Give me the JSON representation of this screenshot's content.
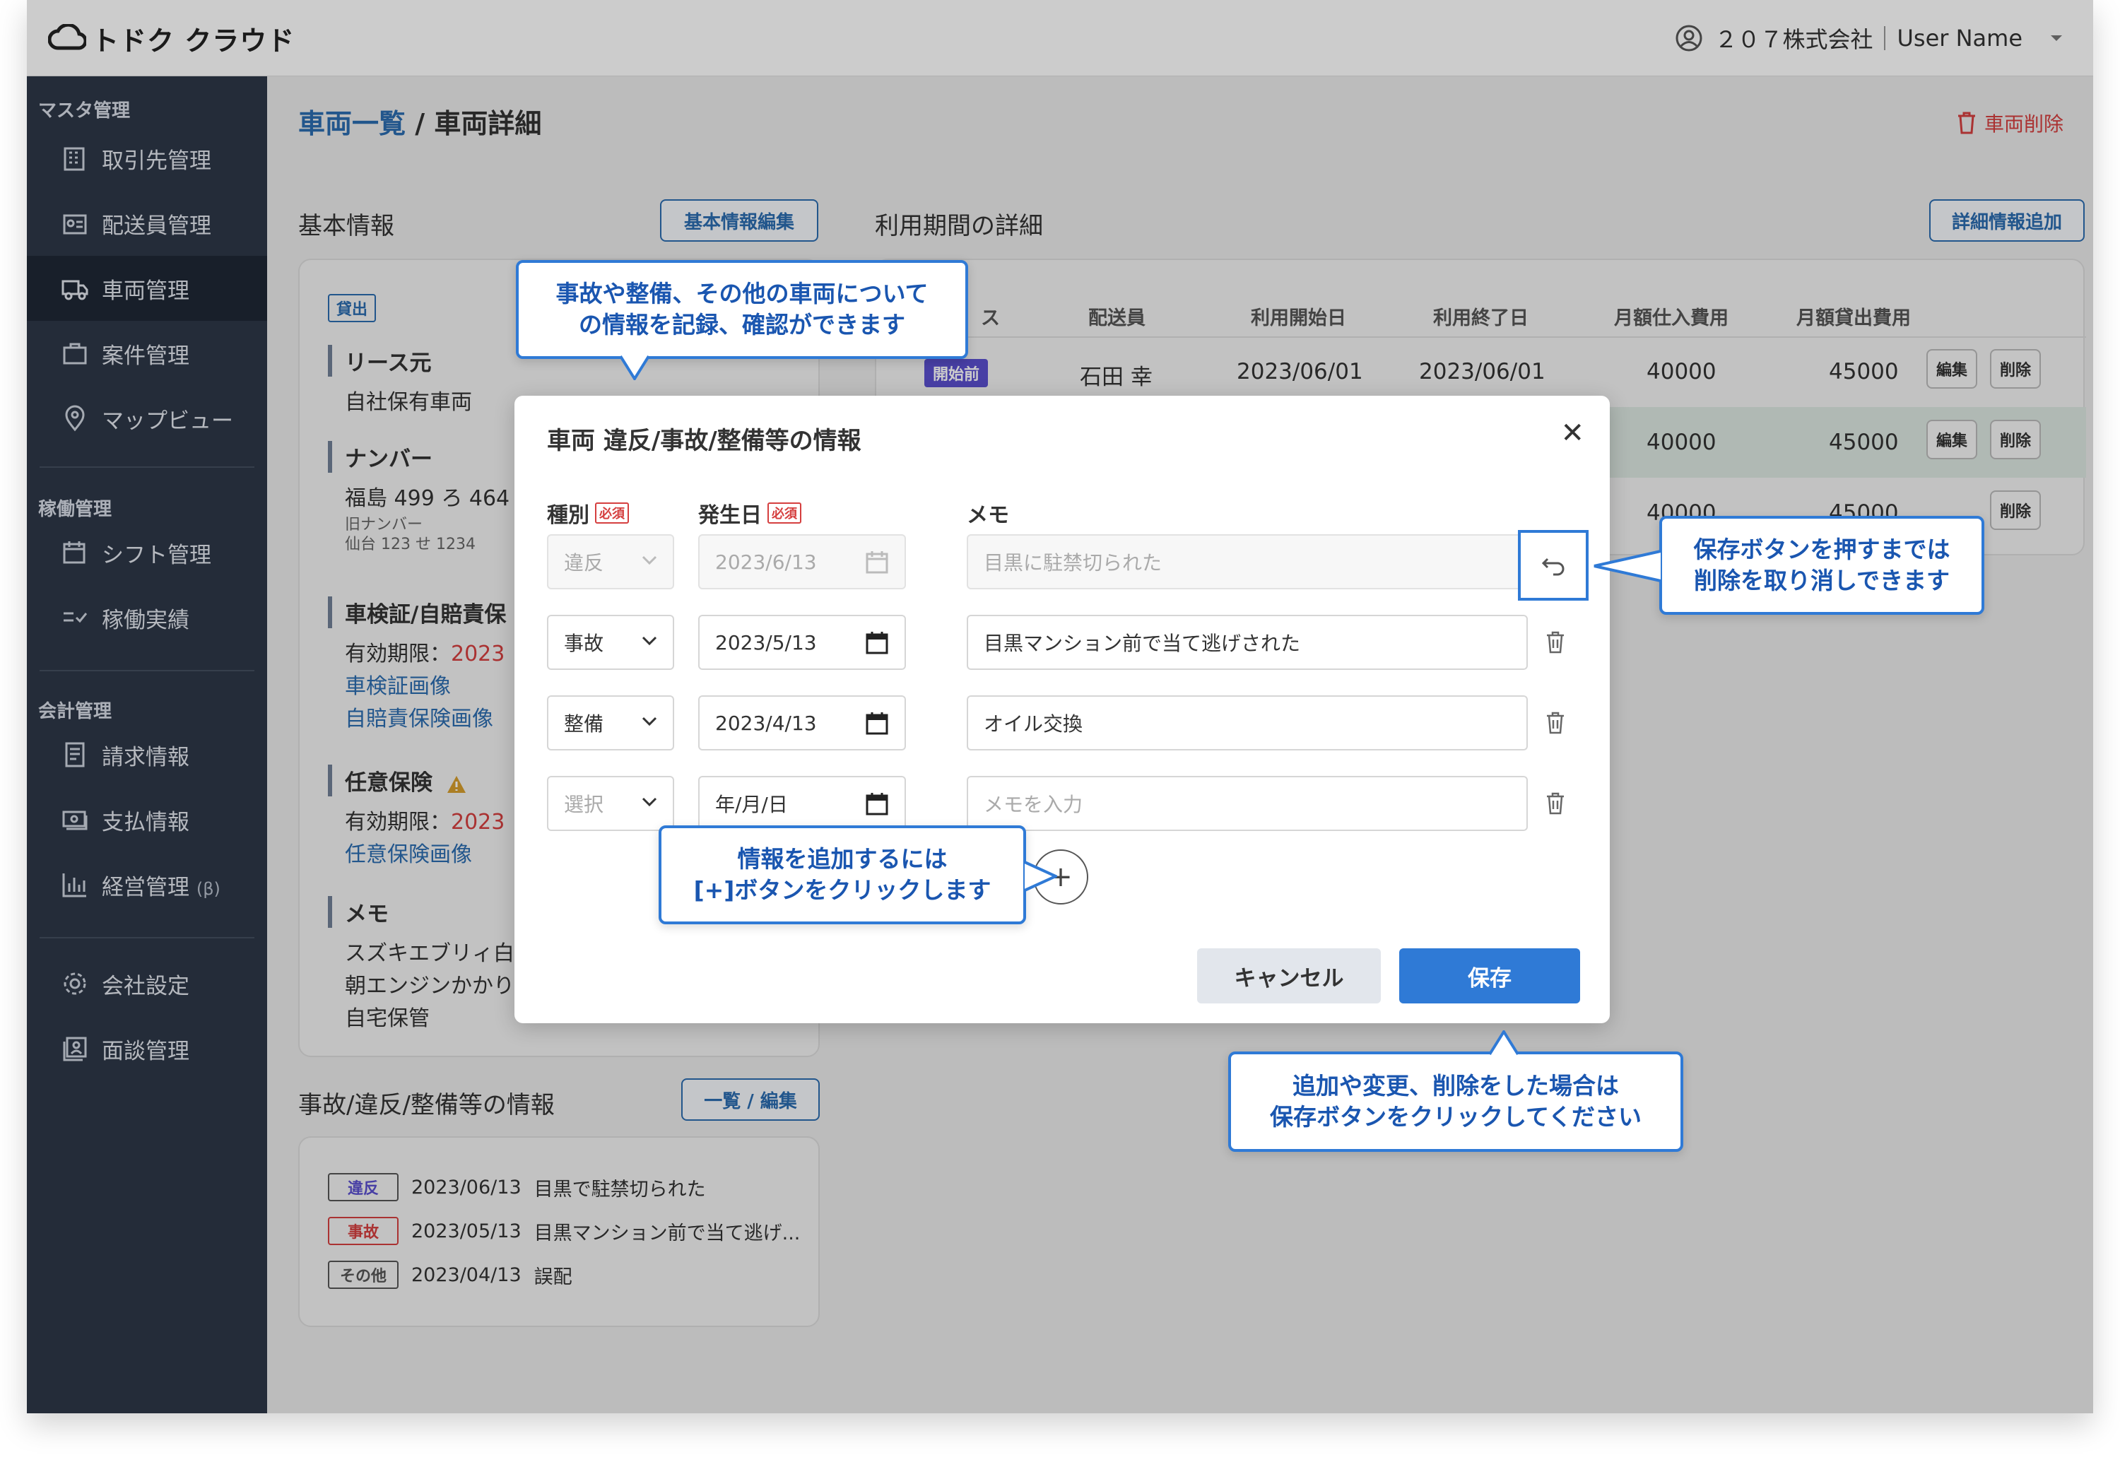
{
  "app": {
    "logo": "トドク クラウド"
  },
  "header": {
    "company": "２０７株式会社",
    "user_name": "User Name"
  },
  "sidebar": {
    "sections": [
      {
        "title": "マスタ管理"
      },
      {
        "title": "稼働管理"
      },
      {
        "title": "会計管理"
      }
    ],
    "items": [
      {
        "label": "取引先管理",
        "icon": "building-icon"
      },
      {
        "label": "配送員管理",
        "icon": "id-badge-icon"
      },
      {
        "label": "車両管理",
        "icon": "truck-icon"
      },
      {
        "label": "案件管理",
        "icon": "briefcase-icon"
      },
      {
        "label": "マップビュー",
        "icon": "map-pin-icon"
      },
      {
        "label": "シフト管理",
        "icon": "calendar-icon"
      },
      {
        "label": "稼働実績",
        "icon": "checklist-icon"
      },
      {
        "label": "請求情報",
        "icon": "receipt-icon"
      },
      {
        "label": "支払情報",
        "icon": "cash-icon"
      },
      {
        "label": "経営管理",
        "beta": "(β)",
        "icon": "bar-chart-icon"
      },
      {
        "label": "会社設定",
        "icon": "gear-icon"
      },
      {
        "label": "面談管理",
        "icon": "portrait-icon"
      }
    ]
  },
  "main": {
    "breadcrumb": {
      "link": "車両一覧",
      "separator": "/",
      "current": "車両詳細"
    },
    "delete_vehicle": "車両削除",
    "basic_info": {
      "title": "基本情報",
      "edit_button": "基本情報編集",
      "tag": "貸出",
      "lease_head": "リース元",
      "lease_value": "自社保有車両",
      "number_head": "ナンバー",
      "number_value": "福島 499 ろ 464",
      "old_number_label": "旧ナンバー",
      "old_number_value": "仙台 123 せ 1234",
      "inspection_head": "車検証/自賠責保",
      "inspection_valid_label": "有効期限：",
      "inspection_valid_value": "2023",
      "inspection_link": "車検証画像",
      "insurance_link": "自賠責保険画像",
      "optional_head": "任意保険",
      "optional_valid_label": "有効期限：",
      "optional_valid_value": "2023",
      "optional_link": "任意保険画像",
      "memo_head": "メモ",
      "memo_lines": [
        "スズキエブリィ白",
        "朝エンジンかかり",
        "自宅保管"
      ]
    },
    "period": {
      "title": "利用期間の詳細",
      "add_button": "詳細情報追加",
      "columns": [
        "ス",
        "配送員",
        "利用開始日",
        "利用終了日",
        "月額仕入費用",
        "月額貸出費用"
      ],
      "rows": [
        {
          "status": "開始前",
          "driver": "石田 幸",
          "start": "2023/06/01",
          "end": "2023/06/01",
          "cost": "40000",
          "rent": "45000",
          "edit": "編集",
          "delete": "削除"
        },
        {
          "cost": "40000",
          "rent": "45000",
          "edit": "編集",
          "delete": "削除"
        },
        {
          "cost": "40000",
          "rent": "45000",
          "delete": "削除"
        }
      ]
    },
    "incidents": {
      "title": "事故/違反/整備等の情報",
      "button": "一覧 / 編集",
      "items": [
        {
          "tag": "違反",
          "tag_color": "#5a4fcf",
          "date": "2023/06/13",
          "text": "目黒で駐禁切られた"
        },
        {
          "tag": "事故",
          "tag_color": "#d53f3f",
          "date": "2023/05/13",
          "text": "目黒マンション前で当て逃げ..."
        },
        {
          "tag": "その他",
          "tag_color": "#555555",
          "date": "2023/04/13",
          "text": "誤配"
        }
      ]
    }
  },
  "modal": {
    "title": "車両 違反/事故/整備等の情報",
    "col_type": "種別",
    "col_date": "発生日",
    "col_memo": "メモ",
    "required": "必須",
    "rows": [
      {
        "type": "違反",
        "date": "2023/6/13",
        "memo": "目黒に駐禁切られた",
        "disabled": true
      },
      {
        "type": "事故",
        "date": "2023/5/13",
        "memo": "目黒マンション前で当て逃げされた"
      },
      {
        "type": "整備",
        "date": "2023/4/13",
        "memo": "オイル交換"
      },
      {
        "type": "選択",
        "date": "年/月/日",
        "memo_placeholder": "メモを入力"
      }
    ],
    "add_symbol": "+",
    "cancel": "キャンセル",
    "save": "保存"
  },
  "callouts": {
    "top": [
      "事故や整備、その他の車両について",
      "の情報を記録、確認ができます"
    ],
    "undo": [
      "保存ボタンを押すまでは",
      "削除を取り消しできます"
    ],
    "add": [
      "情報を追加するには",
      "[+]ボタンをクリックします"
    ],
    "save": [
      "追加や変更、削除をした場合は",
      "保存ボタンをクリックしてください"
    ]
  },
  "colors": {
    "accent": "#2f7ad6",
    "sidebar": "#2d3748",
    "danger": "#d53f3f",
    "link": "#2b6cb0"
  }
}
